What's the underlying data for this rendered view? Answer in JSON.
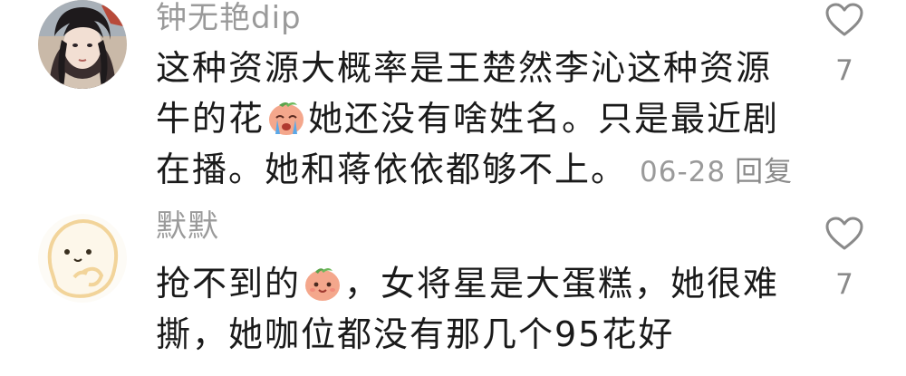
{
  "comments": [
    {
      "username": "钟无艳dip",
      "lines": [
        "这种资源大概率是王楚然李沁这种资源",
        "牛的花",
        "她还没有啥姓名。只是最近剧",
        "在播。她和蒋依依都够不上。"
      ],
      "date": "06-28",
      "reply_label": "回复",
      "like_count": "7",
      "avatar_icon": "anime-portrait-avatar",
      "emoji_icon": "crying-peach-emoji"
    },
    {
      "username": "默默",
      "lines": [
        "抢不到的",
        "，女将星是大蛋糕，她很难",
        "撕，她咖位都没有那几个95花好"
      ],
      "like_count": "7",
      "avatar_icon": "peach-face-avatar",
      "emoji_icon": "smiling-peach-emoji"
    }
  ],
  "colors": {
    "text": "#1a1a1a",
    "meta": "#9a9a9a",
    "heart_outline": "#8a8a8a",
    "peach": "#f4a78c"
  }
}
